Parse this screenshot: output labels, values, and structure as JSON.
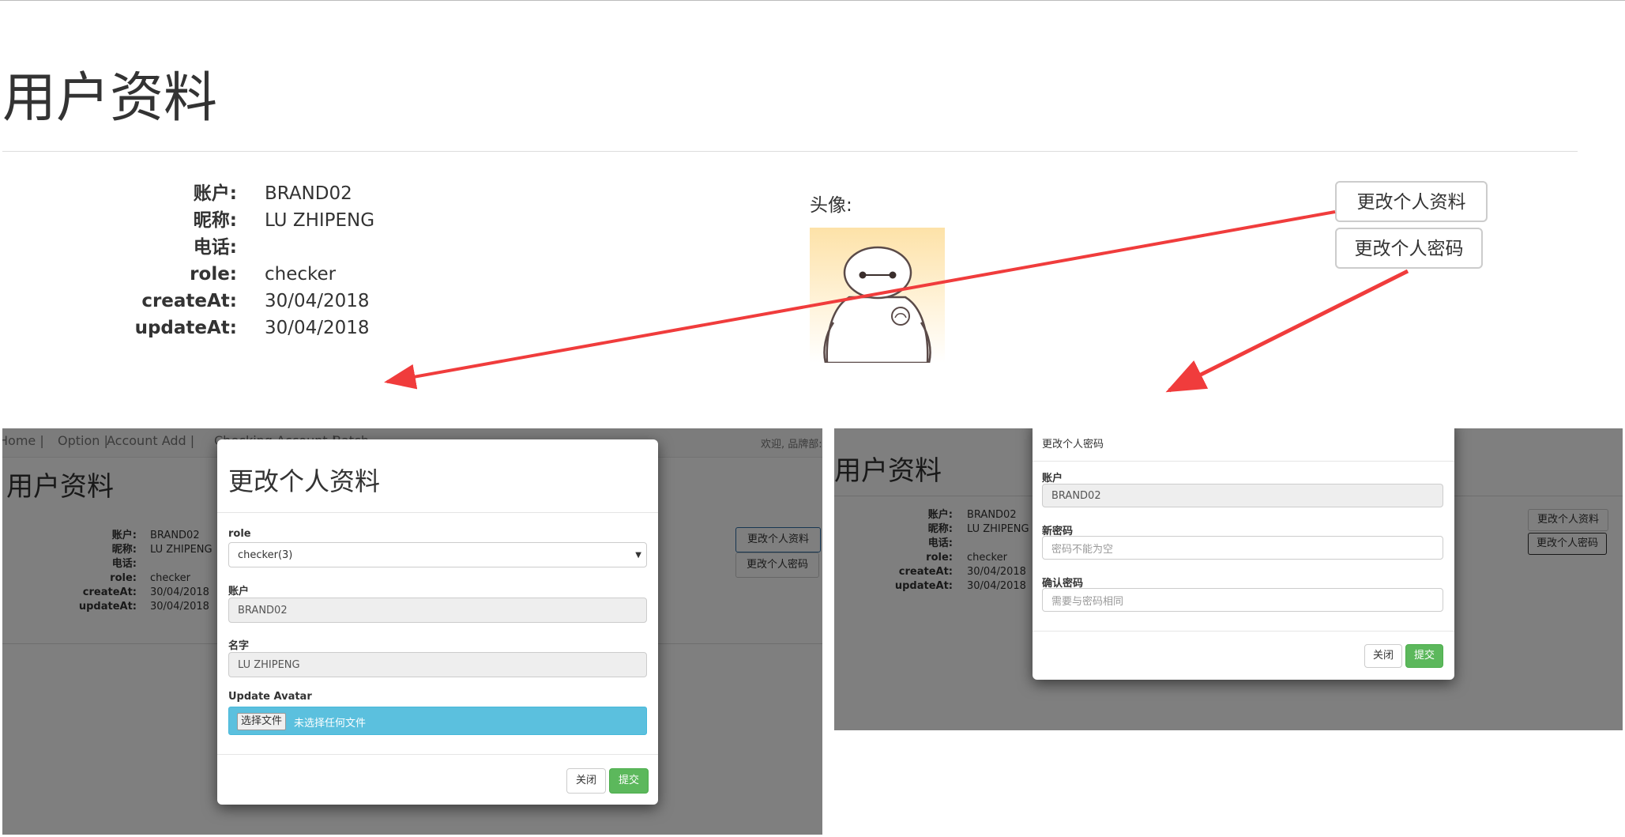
{
  "page": {
    "title": "用户资料",
    "avatar_label": "头像:",
    "fields": [
      {
        "label": "账户:",
        "value": "BRAND02"
      },
      {
        "label": "昵称:",
        "value": "LU ZHIPENG"
      },
      {
        "label": "电话:",
        "value": ""
      },
      {
        "label": "role:",
        "value": "checker"
      },
      {
        "label": "createAt:",
        "value": "30/04/2018"
      },
      {
        "label": "updateAt:",
        "value": "30/04/2018"
      }
    ],
    "buttons": {
      "edit_profile": "更改个人资料",
      "edit_password": "更改个人密码"
    }
  },
  "left_shot": {
    "nav": [
      "Home |",
      "Option |",
      "Account Add |",
      "Checking Account |",
      "Batch"
    ],
    "welcome": "欢迎, 品牌部:",
    "bg_title": "用户资料",
    "modal": {
      "title": "更改个人资料",
      "role_label": "role",
      "role_value": "checker(3)",
      "account_label": "账户",
      "account_value": "BRAND02",
      "name_label": "名字",
      "name_value": "LU ZHIPENG",
      "avatar_label": "Update Avatar",
      "choose_file": "选择文件",
      "no_file": "未选择任何文件",
      "close": "关闭",
      "submit": "提交"
    }
  },
  "right_shot": {
    "bg_title": "用户资料",
    "modal": {
      "title": "更改个人密码",
      "account_label": "账户",
      "account_value": "BRAND02",
      "new_pw_label": "新密码",
      "new_pw_placeholder": "密码不能为空",
      "confirm_label": "确认密码",
      "confirm_placeholder": "需要与密码相同",
      "close": "关闭",
      "submit": "提交"
    }
  },
  "colors": {
    "arrow": "#f03c3c",
    "success": "#5cb85c",
    "file_input": "#5bc0de"
  },
  "icons": {
    "avatar": "baymax-avatar",
    "select_caret": "caret-down-icon"
  }
}
